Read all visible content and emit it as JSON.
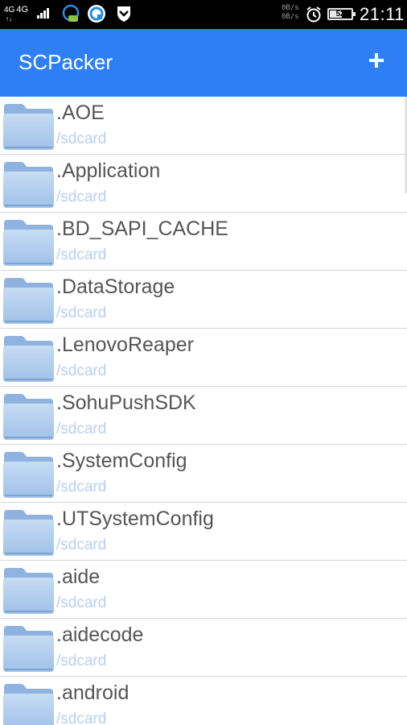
{
  "status_bar": {
    "network_1": "4G",
    "network_2": "4G",
    "speed_up": "0B/s",
    "speed_down": "0B/s",
    "battery": "52",
    "time": "21:11",
    "icons": [
      "signal-icon",
      "chat-app-icon",
      "browser-app-icon",
      "shield-app-icon",
      "alarm-icon",
      "battery-icon"
    ]
  },
  "app_bar": {
    "title": "SCPacker",
    "add_icon": "plus-icon",
    "color": "#2e7ff5"
  },
  "files": [
    {
      "name": ".AOE",
      "path": "/sdcard"
    },
    {
      "name": ".Application",
      "path": "/sdcard"
    },
    {
      "name": ".BD_SAPI_CACHE",
      "path": "/sdcard"
    },
    {
      "name": ".DataStorage",
      "path": "/sdcard"
    },
    {
      "name": ".LenovoReaper",
      "path": "/sdcard"
    },
    {
      "name": ".SohuPushSDK",
      "path": "/sdcard"
    },
    {
      "name": ".SystemConfig",
      "path": "/sdcard"
    },
    {
      "name": ".UTSystemConfig",
      "path": "/sdcard"
    },
    {
      "name": ".aide",
      "path": "/sdcard"
    },
    {
      "name": ".aidecode",
      "path": "/sdcard"
    },
    {
      "name": ".android",
      "path": "/sdcard"
    }
  ],
  "colors": {
    "folder": "#a9c9ec",
    "path_text": "#b9cff3",
    "name_text": "#555555"
  }
}
